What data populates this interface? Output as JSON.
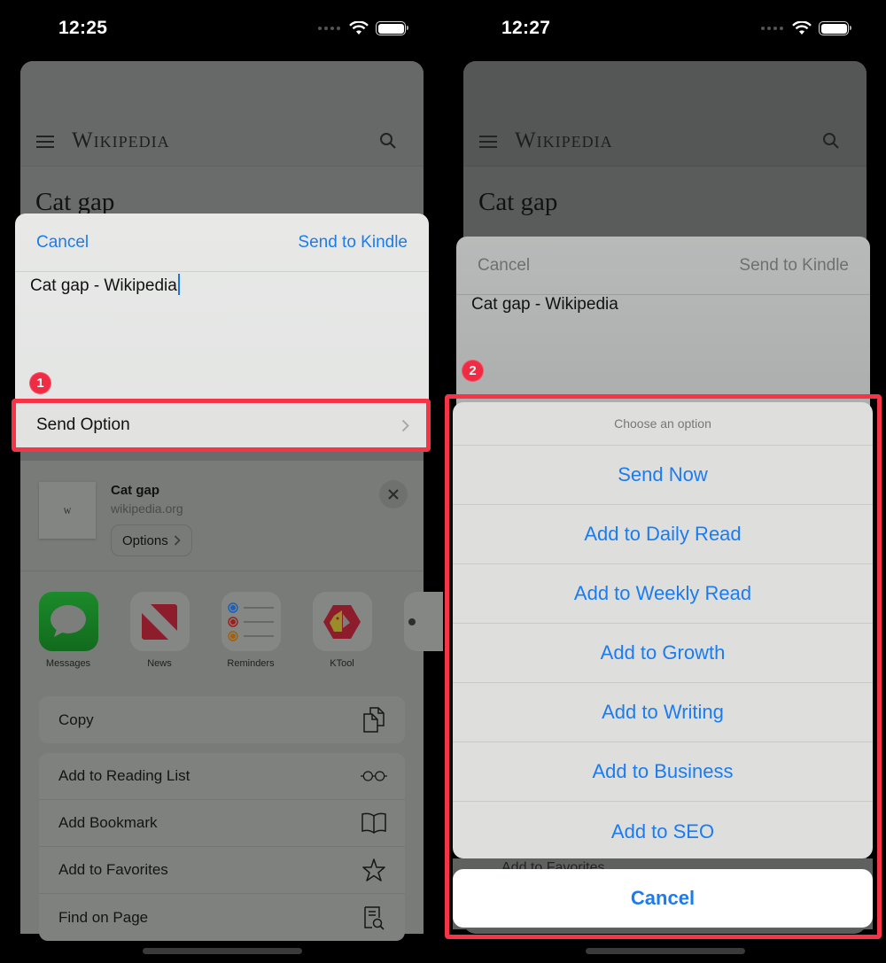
{
  "colors": {
    "ios_blue": "#1a7cf0",
    "highlight_red": "#f53447",
    "badge_red": "#ef2c43"
  },
  "left_screen": {
    "status_bar": {
      "time": "12:25",
      "icons": [
        "cellular-dots-icon",
        "wifi-icon",
        "battery-icon"
      ]
    },
    "background_page": {
      "logo": "Wikipedia",
      "title": "Cat gap"
    },
    "compose": {
      "cancel_label": "Cancel",
      "send_label": "Send to Kindle",
      "text_value": "Cat gap - Wikipedia",
      "send_option_label": "Send Option"
    },
    "step_badge": "1",
    "link_preview": {
      "thumb_letter": "W",
      "title": "Cat gap",
      "domain": "wikipedia.org",
      "options_label": "Options"
    },
    "apps": [
      {
        "name": "Messages",
        "icon": "messages-icon"
      },
      {
        "name": "News",
        "icon": "news-icon"
      },
      {
        "name": "Reminders",
        "icon": "reminders-icon"
      },
      {
        "name": "KTool",
        "icon": "ktool-icon"
      }
    ],
    "actions_primary": [
      {
        "label": "Copy",
        "icon": "copy-icon"
      }
    ],
    "actions_secondary": [
      {
        "label": "Add to Reading List",
        "icon": "glasses-icon"
      },
      {
        "label": "Add Bookmark",
        "icon": "book-icon"
      },
      {
        "label": "Add to Favorites",
        "icon": "star-icon"
      },
      {
        "label": "Find on Page",
        "icon": "find-on-page-icon"
      }
    ]
  },
  "right_screen": {
    "status_bar": {
      "time": "12:27",
      "icons": [
        "cellular-dots-icon",
        "wifi-icon",
        "battery-icon"
      ]
    },
    "background_page": {
      "logo": "Wikipedia",
      "title": "Cat gap"
    },
    "compose": {
      "cancel_label": "Cancel",
      "send_label": "Send to Kindle",
      "text_value": "Cat gap - Wikipedia"
    },
    "step_badge": "2",
    "action_sheet": {
      "title": "Choose an option",
      "options": [
        "Send Now",
        "Add to Daily Read",
        "Add to Weekly Read",
        "Add to Growth",
        "Add to Writing",
        "Add to Business",
        "Add to SEO"
      ],
      "cancel_label": "Cancel"
    },
    "obscured_row_label": "Add to Favorites"
  }
}
